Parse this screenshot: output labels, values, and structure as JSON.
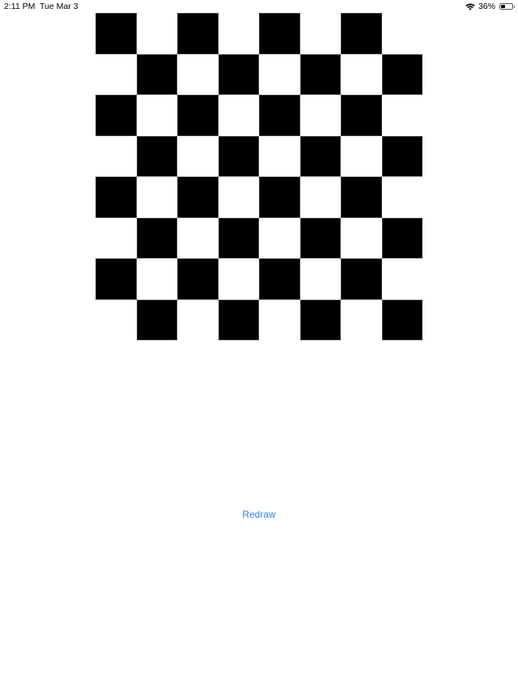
{
  "status_bar": {
    "time": "2:11 PM",
    "date": "Tue Mar 3",
    "battery_percent_label": "36%",
    "battery_level": 0.36,
    "wifi_icon": "wifi-icon",
    "battery_icon": "battery-icon"
  },
  "board": {
    "rows": 8,
    "columns": 8,
    "dark_color": "#000000",
    "light_color": "#ffffff",
    "top_left_square": "dark"
  },
  "actions": {
    "redraw_label": "Redraw"
  },
  "colors": {
    "accent": "#2f7ef6",
    "background": "#ffffff"
  }
}
